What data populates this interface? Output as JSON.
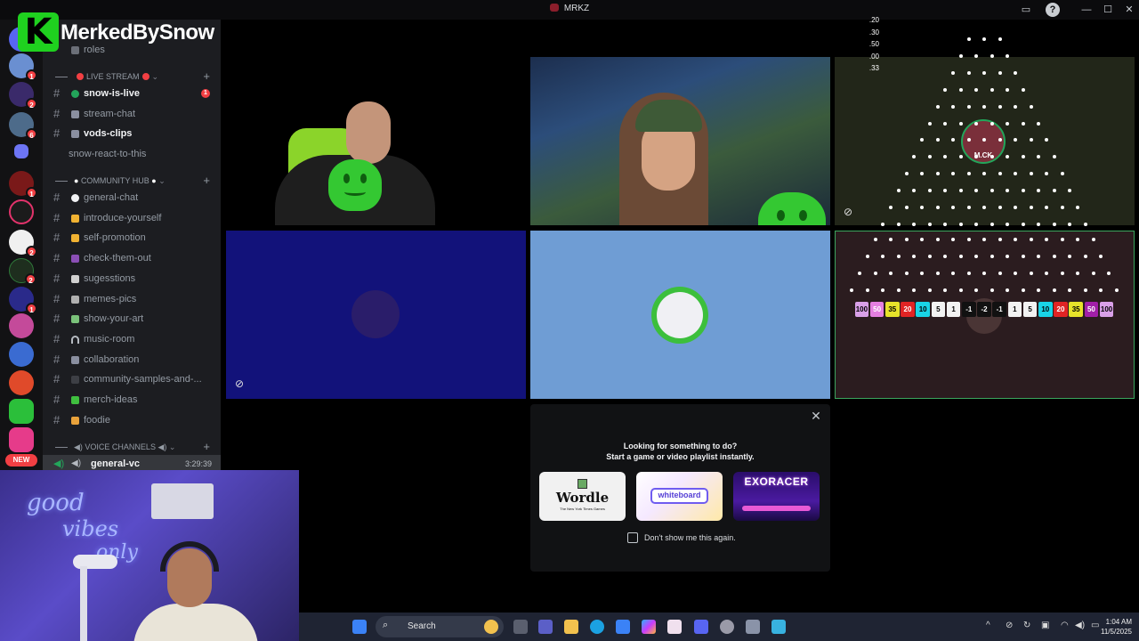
{
  "window": {
    "title": "MRKZ"
  },
  "overlay_logo": {
    "text": "MerkedBySnow",
    "letter": "K"
  },
  "servers": {
    "badges": [
      "1",
      "2",
      "6",
      "1",
      "2",
      "2",
      "1"
    ],
    "new_label": "NEW"
  },
  "channels": {
    "top_partial": "roles",
    "live_category": "LIVE STREAM",
    "live_items": [
      {
        "name": "snow-is-live",
        "badge": "1"
      },
      {
        "name": "stream-chat"
      },
      {
        "name": "vods-clips"
      },
      {
        "name": "snow-react-to-this"
      }
    ],
    "community_category": "COMMUNITY HUB",
    "community_items": [
      "general-chat",
      "introduce-yourself",
      "self-promotion",
      "check-them-out",
      "sugesstions",
      "memes-pics",
      "show-your-art",
      "music-room",
      "collaboration",
      "community-samples-and-...",
      "merch-ideas",
      "foodie"
    ],
    "voice_category": "VOICE CHANNELS",
    "voice_items": [
      {
        "name": "general-vc",
        "time": "3:29:39"
      }
    ]
  },
  "odds": [
    ".20",
    ".30",
    ".50",
    ".00",
    ".33"
  ],
  "plinko": {
    "slots": [
      "100",
      "50",
      "35",
      "20",
      "10",
      "5",
      "1",
      "-1",
      "-2",
      "-1",
      "1",
      "5",
      "10",
      "20",
      "35",
      "50",
      "100"
    ],
    "slot_colors": [
      "#d9a0e8",
      "#e47fe0",
      "#e6e22a",
      "#e02424",
      "#19d4e6",
      "#f2f2f2",
      "#f2f2f2",
      "#111111",
      "#111111",
      "#111111",
      "#f2f2f2",
      "#f2f2f2",
      "#19d4e6",
      "#e02424",
      "#e6e22a",
      "#a21fa8",
      "#d9a0e8"
    ],
    "marker_text": "M.CK"
  },
  "activity": {
    "line1": "Looking for something to do?",
    "line2": "Start a game or video playlist instantly.",
    "cards": [
      {
        "title": "Wordle",
        "subtitle": "The New York Times Games"
      },
      {
        "title": "whiteboard",
        "subtitle": ""
      },
      {
        "title": "EXORACER",
        "subtitle": ""
      }
    ],
    "checkbox_label": "Don't show me this again."
  },
  "webcam": {
    "neon_text_1": "good",
    "neon_text_2": "vibes",
    "neon_text_3": "only"
  },
  "taskbar": {
    "search_label": "Search",
    "time": "1:04 AM",
    "date": "11/5/2025"
  },
  "accent_colors": {
    "discord_red": "#f23f43",
    "online_green": "#23a55a",
    "brand_green": "#1fd11f"
  }
}
